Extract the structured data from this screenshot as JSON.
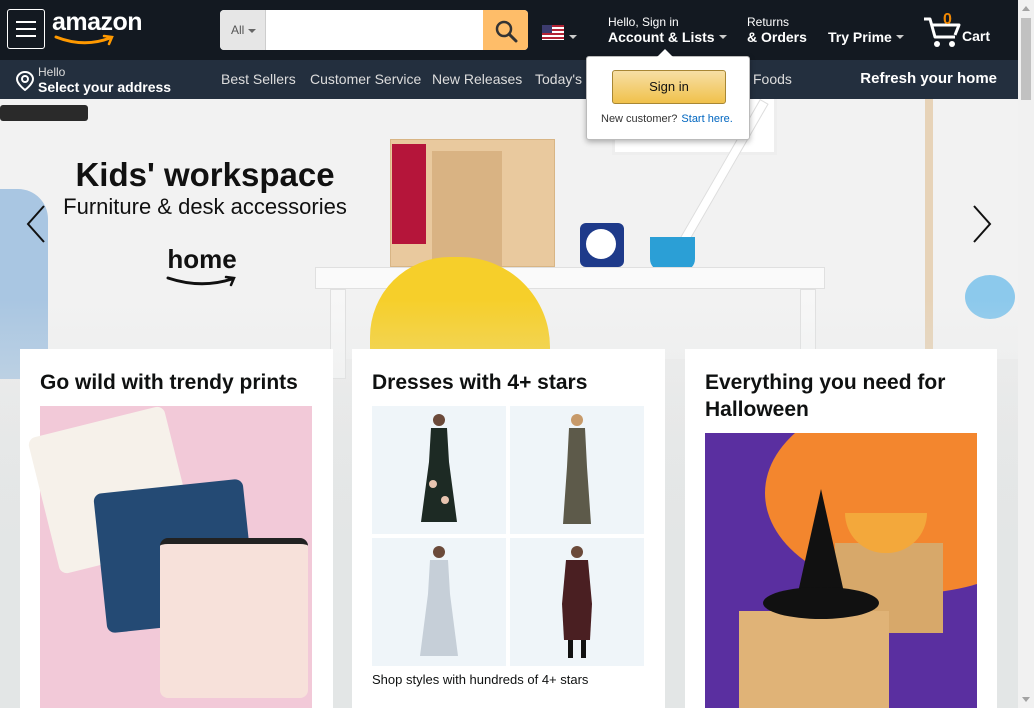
{
  "header": {
    "logo_text": "amazon",
    "search": {
      "department": "All",
      "placeholder": "",
      "value": ""
    },
    "account": {
      "line1": "Hello, Sign in",
      "line2": "Account & Lists"
    },
    "orders": {
      "line1": "Returns",
      "line2": "& Orders"
    },
    "prime": {
      "label": "Try Prime"
    },
    "cart": {
      "count": "0",
      "label": "Cart"
    },
    "icons": [
      "menu-icon",
      "search-icon",
      "us-flag-icon",
      "cart-icon"
    ]
  },
  "subnav": {
    "address": {
      "line1": "Hello",
      "line2": "Select your address"
    },
    "items": [
      {
        "label": "Best Sellers"
      },
      {
        "label": "Customer Service"
      },
      {
        "label": "New Releases"
      },
      {
        "label": "Today's D"
      },
      {
        "label": "Foods"
      }
    ],
    "promo": "Refresh your home"
  },
  "hero": {
    "title": "Kids' workspace",
    "subtitle": "Furniture & desk accessories",
    "brand": "home"
  },
  "flyout": {
    "signin_label": "Sign in",
    "new_customer": "New customer?",
    "start_here": "Start here."
  },
  "cards": [
    {
      "title": "Go wild with trendy prints"
    },
    {
      "title": "Dresses with 4+ stars",
      "footer": "Shop styles with hundreds of 4+ stars"
    },
    {
      "title": "Everything you need for Halloween"
    }
  ],
  "colors": {
    "nav_top": "#131921",
    "nav_sub": "#232f3e",
    "search_button": "#febd69",
    "cart_count": "#f08804",
    "signin_button": "#f0c14b",
    "link": "#0066c0"
  }
}
